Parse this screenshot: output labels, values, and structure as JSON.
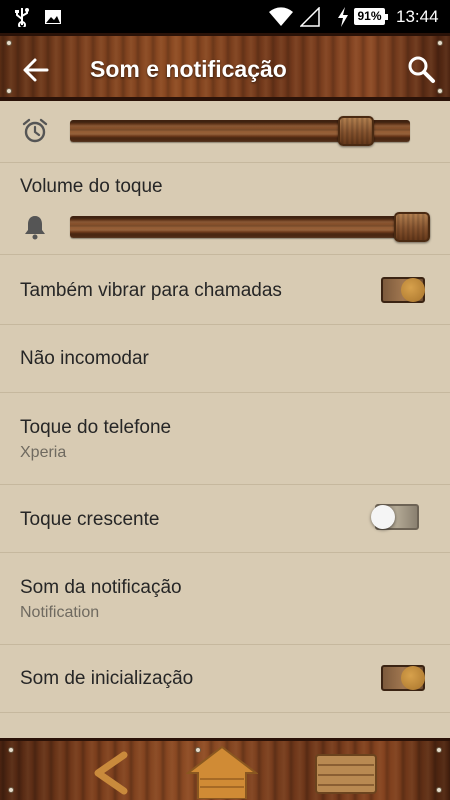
{
  "status_bar": {
    "icons": [
      "usb-icon",
      "image-icon",
      "wifi-icon",
      "no-signal-icon",
      "charging-icon"
    ],
    "battery": "91%",
    "time": "13:44"
  },
  "action_bar": {
    "title": "Som e notificação",
    "icons": {
      "back": "back-arrow-icon",
      "search": "search-icon"
    }
  },
  "settings": {
    "alarm_volume": {
      "icon": "alarm-clock-icon",
      "level": 0.88
    },
    "ring_volume": {
      "title": "Volume do toque",
      "icon": "bell-icon",
      "level": 1.0
    },
    "vibrate_calls": {
      "title": "Também vibrar para chamadas",
      "enabled": true
    },
    "do_not_disturb": {
      "title": "Não incomodar"
    },
    "phone_ringtone": {
      "title": "Toque do telefone",
      "summary": "Xperia"
    },
    "ascending_ring": {
      "title": "Toque crescente",
      "enabled": false
    },
    "notification_sound": {
      "title": "Som da notificação",
      "summary": "Notification"
    },
    "startup_sound": {
      "title": "Som de inicialização",
      "enabled": true
    }
  },
  "nav_bar": {
    "icons": [
      "back-nav-icon",
      "home-nav-icon",
      "recents-nav-icon"
    ]
  },
  "colors": {
    "background": "#d8cbb3",
    "wood": "#7a3f1e",
    "text_primary": "#262626",
    "text_secondary": "#6f6a60",
    "toggle_on": "#c48a3a"
  }
}
